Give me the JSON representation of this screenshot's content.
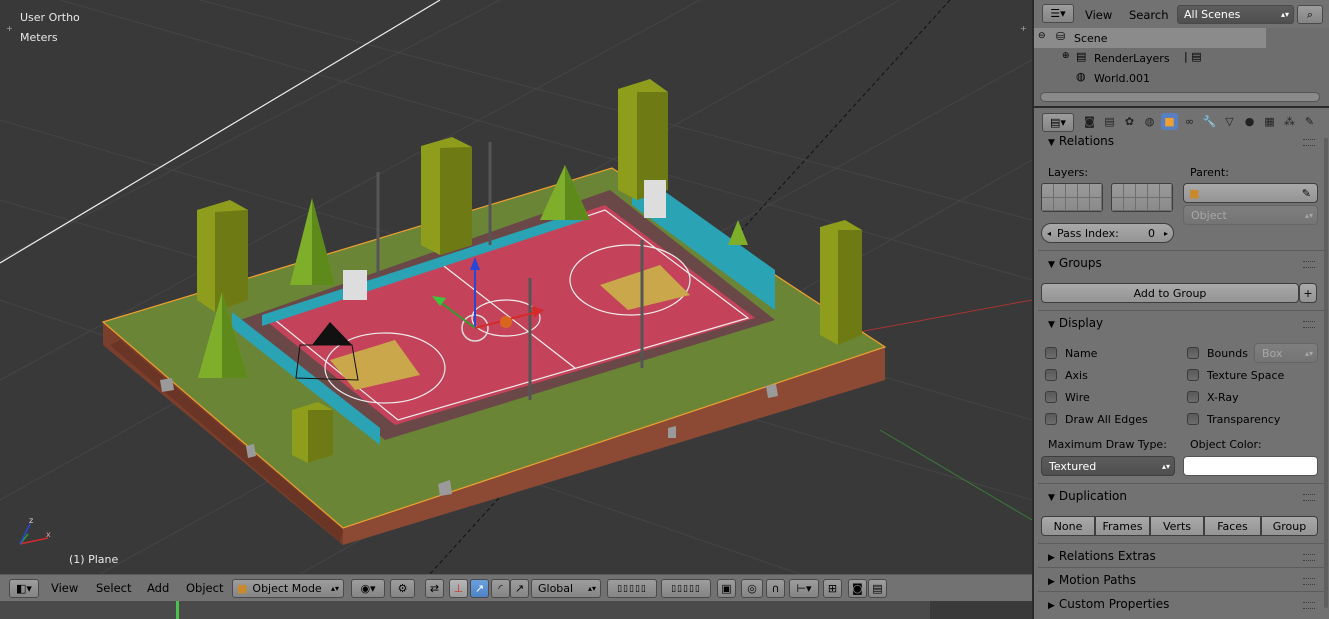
{
  "viewport": {
    "view_name": "User Ortho",
    "units": "Meters",
    "object_info": "(1) Plane",
    "axis_x": "x",
    "axis_y": "y",
    "axis_z": "z"
  },
  "header": {
    "menus": [
      "View",
      "Select",
      "Add",
      "Object"
    ],
    "mode": "Object Mode",
    "orientation": "Global"
  },
  "outliner": {
    "menu_view": "View",
    "menu_search": "Search",
    "scene_filter": "All Scenes",
    "items": [
      "Scene",
      "RenderLayers",
      "World.001"
    ]
  },
  "properties": {
    "relations": {
      "title": "Relations",
      "layers_label": "Layers:",
      "parent_label": "Parent:",
      "parent_type": "Object",
      "pass_index_label": "Pass Index:",
      "pass_index_value": "0"
    },
    "groups": {
      "title": "Groups",
      "add_button": "Add to Group"
    },
    "display": {
      "title": "Display",
      "left_checks": [
        "Name",
        "Axis",
        "Wire",
        "Draw All Edges"
      ],
      "right_checks": [
        "Bounds",
        "Texture Space",
        "X-Ray",
        "Transparency"
      ],
      "bounds_type": "Box",
      "max_draw_label": "Maximum Draw Type:",
      "max_draw_value": "Textured",
      "object_color_label": "Object Color:"
    },
    "duplication": {
      "title": "Duplication",
      "options": [
        "None",
        "Frames",
        "Verts",
        "Faces",
        "Group"
      ],
      "active": "None"
    },
    "collapsed": [
      "Relations Extras",
      "Motion Paths",
      "Custom Properties"
    ]
  },
  "colors": {
    "viewport_bg": "#393939",
    "panel_bg": "#727272",
    "active_blue": "#5680c2",
    "court_red": "#c5435a",
    "grass": "#6f8a3a",
    "wall_cyan": "#2aa3b5",
    "tree_green": "#7fae2b",
    "block_olive": "#8e9d1c",
    "dirt": "#8c4a35",
    "selection_outline": "#f0a030"
  }
}
